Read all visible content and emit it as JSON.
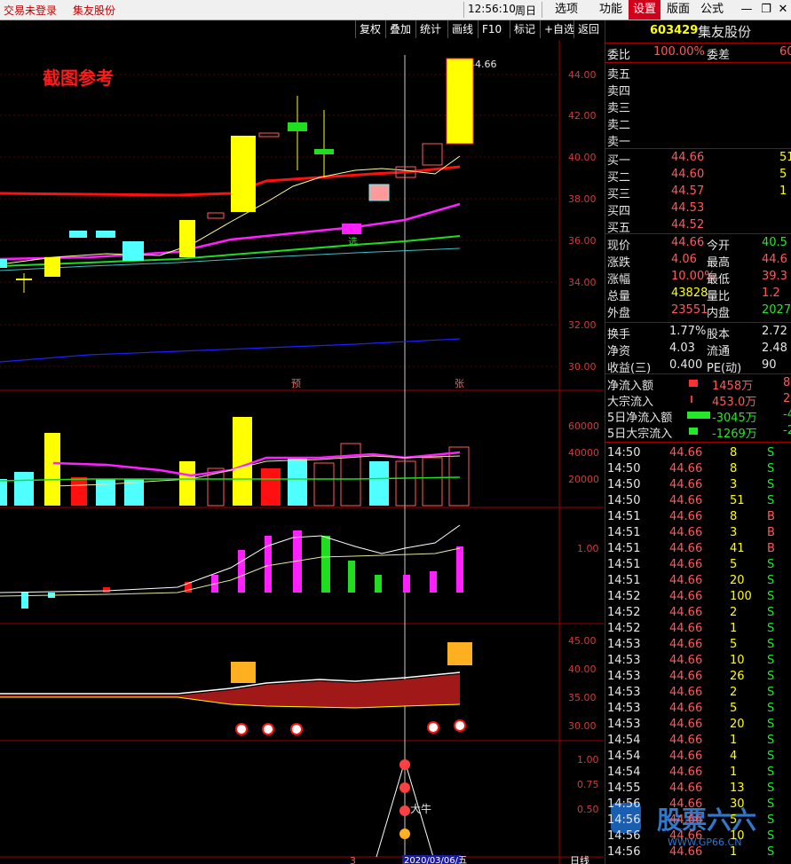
{
  "titlebar": {
    "status": "交易未登录",
    "stock": "集友股份",
    "time": "12:56:10",
    "weekday": "周日",
    "menu": [
      "选项",
      "功能",
      "设置",
      "版面",
      "公式"
    ],
    "min_icon": "minimize-icon",
    "restore_icon": "restore-icon",
    "close_icon": "close-icon"
  },
  "toolbar": [
    "复权",
    "叠加",
    "统计",
    "画线",
    "F10",
    "标记",
    "+自选",
    "返回"
  ],
  "chart": {
    "watermark": "截图参考",
    "price_ticks": [
      "44.00",
      "42.00",
      "40.00",
      "38.00",
      "36.00",
      "34.00",
      "32.00",
      "30.00"
    ],
    "price_label": "44.66",
    "markers": {
      "xuan": "选",
      "yu": "预",
      "zhang": "张",
      "dazhang": "大牛"
    },
    "vol_ticks": [
      "60000",
      "40000",
      "20000"
    ],
    "ind1_ticks": [
      "1.00"
    ],
    "ind2_ticks": [
      "45.00",
      "40.00",
      "35.00",
      "30.00"
    ],
    "ind3_ticks": [
      "1.00",
      "0.75",
      "0.50"
    ],
    "date_label": "2020/03/06/五",
    "bottom_tab": "日线",
    "bottom_mark": "3",
    "colors": {
      "up": "#ff3030",
      "down": "#50ffff",
      "ma_red": "#ff1010",
      "ma_pink": "#ff20ff",
      "ma_green": "#20dd20",
      "ma_blue": "#3030ff"
    }
  },
  "panel": {
    "code": "603429",
    "name": "集友股份",
    "weibi_label": "委比",
    "weibi_value": "100.00%",
    "weicha_label": "委差",
    "weicha_value": "60",
    "asks": [
      {
        "label": "卖五",
        "price": "",
        "vol": ""
      },
      {
        "label": "卖四",
        "price": "",
        "vol": ""
      },
      {
        "label": "卖三",
        "price": "",
        "vol": ""
      },
      {
        "label": "卖二",
        "price": "",
        "vol": ""
      },
      {
        "label": "卖一",
        "price": "",
        "vol": ""
      }
    ],
    "bids": [
      {
        "label": "买一",
        "price": "44.66",
        "vol": "51"
      },
      {
        "label": "买二",
        "price": "44.60",
        "vol": "5"
      },
      {
        "label": "买三",
        "price": "44.57",
        "vol": "1"
      },
      {
        "label": "买四",
        "price": "44.53",
        "vol": ""
      },
      {
        "label": "买五",
        "price": "44.52",
        "vol": ""
      }
    ],
    "stats": [
      {
        "l1": "现价",
        "v1": "44.66",
        "l2": "今开",
        "v2": "40.5"
      },
      {
        "l1": "涨跌",
        "v1": "4.06",
        "l2": "最高",
        "v2": "44.6"
      },
      {
        "l1": "涨幅",
        "v1": "10.00%",
        "l2": "最低",
        "v2": "39.3"
      },
      {
        "l1": "总量",
        "v1": "43828",
        "l2": "量比",
        "v2": "1.2"
      },
      {
        "l1": "外盘",
        "v1": "23551",
        "l2": "内盘",
        "v2": "2027"
      }
    ],
    "stats2": [
      {
        "l1": "换手",
        "v1": "1.77%",
        "l2": "股本",
        "v2": "2.72"
      },
      {
        "l1": "净资",
        "v1": "4.03",
        "l2": "流通",
        "v2": "2.48"
      },
      {
        "l1": "收益(三)",
        "v1": "0.400",
        "l2": "PE(动)",
        "v2": "90"
      }
    ],
    "flows": [
      {
        "label": "净流入额",
        "value": "1458万",
        "extra": "8"
      },
      {
        "label": "大宗流入",
        "value": "453.0万",
        "extra": "2"
      },
      {
        "label": "5日净流入额",
        "value": "-3045万",
        "extra": "-4"
      },
      {
        "label": "5日大宗流入",
        "value": "-1269万",
        "extra": "-2"
      }
    ],
    "ticks": [
      {
        "t": "14:50",
        "p": "44.66",
        "v": "8",
        "s": "S"
      },
      {
        "t": "14:50",
        "p": "44.66",
        "v": "8",
        "s": "S"
      },
      {
        "t": "14:50",
        "p": "44.66",
        "v": "3",
        "s": "S"
      },
      {
        "t": "14:50",
        "p": "44.66",
        "v": "51",
        "s": "S"
      },
      {
        "t": "14:51",
        "p": "44.66",
        "v": "8",
        "s": "B"
      },
      {
        "t": "14:51",
        "p": "44.66",
        "v": "3",
        "s": "B"
      },
      {
        "t": "14:51",
        "p": "44.66",
        "v": "41",
        "s": "B"
      },
      {
        "t": "14:51",
        "p": "44.66",
        "v": "5",
        "s": "S"
      },
      {
        "t": "14:51",
        "p": "44.66",
        "v": "20",
        "s": "S"
      },
      {
        "t": "14:52",
        "p": "44.66",
        "v": "100",
        "s": "S"
      },
      {
        "t": "14:52",
        "p": "44.66",
        "v": "2",
        "s": "S"
      },
      {
        "t": "14:52",
        "p": "44.66",
        "v": "1",
        "s": "S"
      },
      {
        "t": "14:53",
        "p": "44.66",
        "v": "5",
        "s": "S"
      },
      {
        "t": "14:53",
        "p": "44.66",
        "v": "10",
        "s": "S"
      },
      {
        "t": "14:53",
        "p": "44.66",
        "v": "26",
        "s": "S"
      },
      {
        "t": "14:53",
        "p": "44.66",
        "v": "2",
        "s": "S"
      },
      {
        "t": "14:53",
        "p": "44.66",
        "v": "5",
        "s": "S"
      },
      {
        "t": "14:53",
        "p": "44.66",
        "v": "20",
        "s": "S"
      },
      {
        "t": "14:54",
        "p": "44.66",
        "v": "1",
        "s": "S"
      },
      {
        "t": "14:54",
        "p": "44.66",
        "v": "4",
        "s": "S"
      },
      {
        "t": "14:54",
        "p": "44.66",
        "v": "1",
        "s": "S"
      },
      {
        "t": "14:55",
        "p": "44.66",
        "v": "13",
        "s": "S"
      },
      {
        "t": "14:56",
        "p": "44.66",
        "v": "30",
        "s": "S"
      },
      {
        "t": "14:56",
        "p": "44.66",
        "v": "5",
        "s": "S"
      },
      {
        "t": "14:56",
        "p": "44.66",
        "v": "10",
        "s": "S"
      },
      {
        "t": "14:56",
        "p": "44.66",
        "v": "1",
        "s": "S"
      }
    ],
    "logo_text": "股票六六",
    "logo_url": "WWW.GP66.CN"
  }
}
